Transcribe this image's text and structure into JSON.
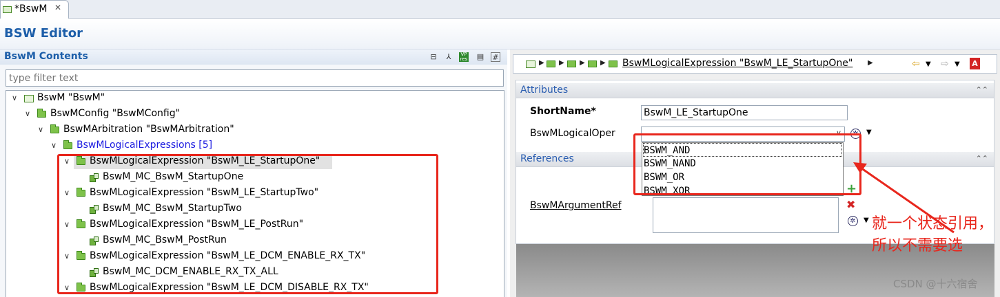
{
  "tab": {
    "label": "*BswM",
    "close": "✕"
  },
  "header": {
    "title": "BSW Editor"
  },
  "left": {
    "title": "BswM Contents",
    "filter_placeholder": "type filter text",
    "tree": [
      {
        "label": "BswM \"BswM\""
      },
      {
        "label": "BswMConfig \"BswMConfig\""
      },
      {
        "label": "BswMArbitration \"BswMArbitration\""
      },
      {
        "label": "BswMLogicalExpressions [5]"
      },
      {
        "label": "BswMLogicalExpression \"BswM_LE_StartupOne\""
      },
      {
        "label": "BswM_MC_BswM_StartupOne"
      },
      {
        "label": "BswMLogicalExpression \"BswM_LE_StartupTwo\""
      },
      {
        "label": "BswM_MC_BswM_StartupTwo"
      },
      {
        "label": "BswMLogicalExpression \"BswM_LE_PostRun\""
      },
      {
        "label": "BswM_MC_BswM_PostRun"
      },
      {
        "label": "BswMLogicalExpression \"BswM_LE_DCM_ENABLE_RX_TX\""
      },
      {
        "label": "BswM_MC_DCM_ENABLE_RX_TX_ALL"
      },
      {
        "label": "BswMLogicalExpression \"BswM_LE_DCM_DISABLE_RX_TX\""
      }
    ],
    "toolbar_icons": [
      "collapse-all-icon",
      "hierarchy-icon",
      "vp-res-icon",
      "page-icon",
      "grid-icon"
    ]
  },
  "right": {
    "breadcrumb": "BswMLogicalExpression \"BswM_LE_StartupOne\"",
    "attributes_title": "Attributes",
    "shortname_label": "ShortName*",
    "shortname_value": "BswM_LE_StartupOne",
    "operator_label": "BswMLogicalOper",
    "operator_options": [
      "BSWM_AND",
      "BSWM_NAND",
      "BSWM_OR",
      "BSWM_XOR"
    ],
    "references_title": "References",
    "argument_ref_label": "BswMArgumentRef"
  },
  "annotation": {
    "note": "就一个状态引用，所以不需要选"
  },
  "watermark": "CSDN @十六宿舍",
  "colors": {
    "accent": "#1d5ea9",
    "annotation_red": "#e8261c",
    "folder_green": "#7ec24a"
  }
}
